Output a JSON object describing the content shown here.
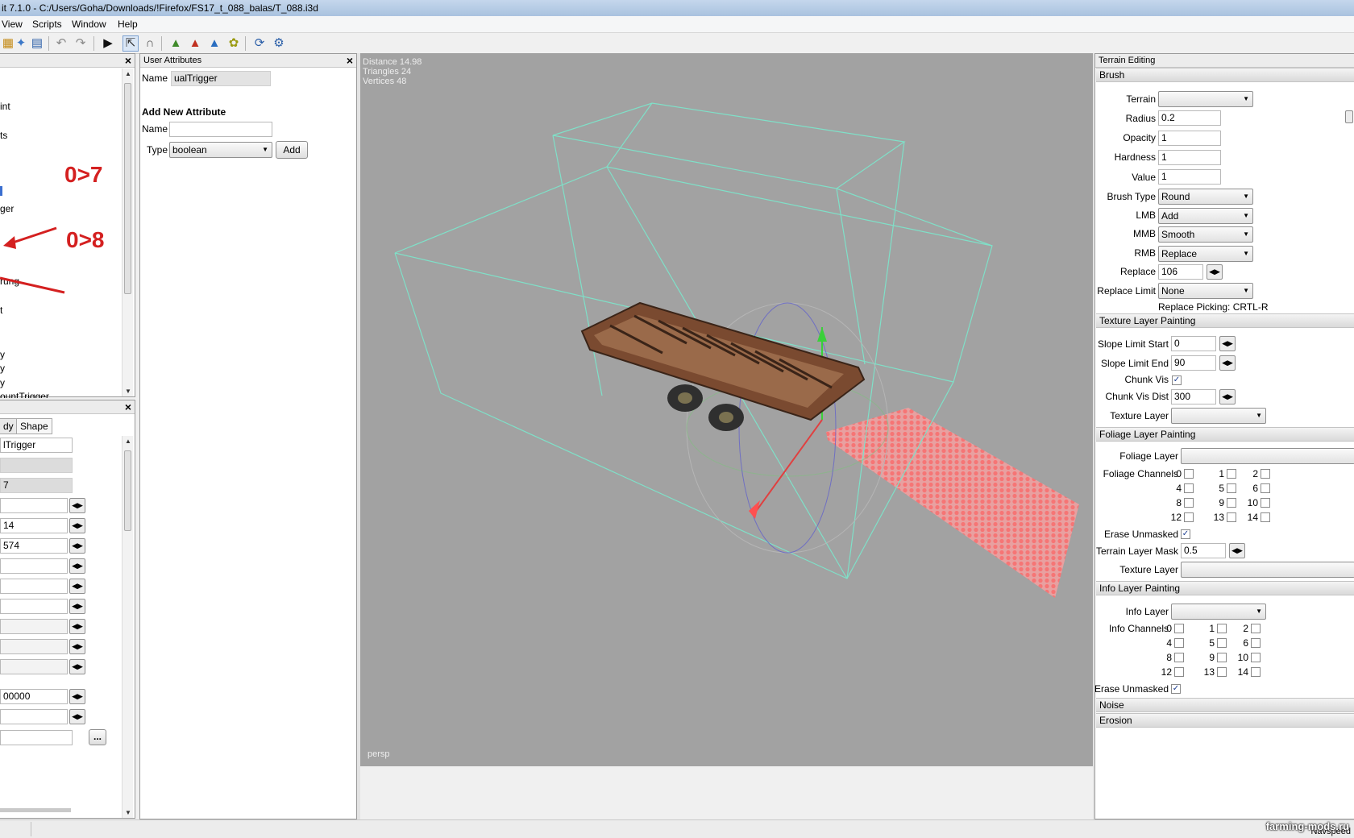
{
  "window": {
    "title": "it 7.1.0 - C:/Users/Goha/Downloads/!Firefox/FS17_t_088_balas/T_088.i3d"
  },
  "menu": {
    "view": "View",
    "scripts": "Scripts",
    "window": "Window",
    "help": "Help"
  },
  "toolbar": {
    "icons": [
      "open-icon",
      "save-icon",
      "import-icon",
      "undo-icon",
      "redo-icon",
      "play-icon",
      "select-icon",
      "magnet-icon",
      "terrain-icon",
      "paint-icon",
      "foliage-icon",
      "info-icon",
      "refresh-icon",
      "settings-icon"
    ]
  },
  "scenegraph": {
    "items": [
      "int",
      "ts",
      "ger",
      "rung",
      "t",
      "y",
      "y",
      "y",
      "ountTrigger"
    ],
    "annotations": [
      "0>7",
      "0>8"
    ]
  },
  "attributes_panel": {
    "tabs": [
      "dy",
      "Shape"
    ],
    "name_value": "lTrigger",
    "id_value": "7",
    "values": [
      "",
      "14",
      "574",
      "",
      "",
      "",
      "",
      "",
      "",
      "00000",
      "",
      ""
    ],
    "more_button": "..."
  },
  "user_attributes": {
    "title": "User Attributes",
    "name_label": "Name",
    "name_value": "ualTrigger",
    "add_heading": "Add New Attribute",
    "new_name_label": "Name",
    "new_name_value": "",
    "type_label": "Type",
    "type_value": "boolean",
    "add_button": "Add"
  },
  "viewport": {
    "distance": "Distance 14.98",
    "triangles": "Triangles 24",
    "vertices": "Vertices 48",
    "camera": "persp"
  },
  "terrain_editing": {
    "title": "Terrain Editing",
    "brush": {
      "header": "Brush",
      "terrain_label": "Terrain",
      "terrain_value": "",
      "radius_label": "Radius",
      "radius_value": "0.2",
      "opacity_label": "Opacity",
      "opacity_value": "1",
      "hardness_label": "Hardness",
      "hardness_value": "1",
      "value_label": "Value",
      "value_value": "1",
      "brush_type_label": "Brush Type",
      "brush_type_value": "Round",
      "lmb_label": "LMB",
      "lmb_value": "Add",
      "mmb_label": "MMB",
      "mmb_value": "Smooth",
      "rmb_label": "RMB",
      "rmb_value": "Replace",
      "replace_label": "Replace",
      "replace_value": "106",
      "replace_limit_label": "Replace Limit",
      "replace_limit_value": "None",
      "replace_picking": "Replace Picking: CRTL-R"
    },
    "texture": {
      "header": "Texture Layer Painting",
      "slope_start_label": "Slope Limit Start",
      "slope_start_value": "0",
      "slope_end_label": "Slope Limit End",
      "slope_end_value": "90",
      "chunk_vis_label": "Chunk Vis",
      "chunk_vis_checked": true,
      "chunk_vis_dist_label": "Chunk Vis Dist",
      "chunk_vis_dist_value": "300",
      "texture_layer_label": "Texture Layer",
      "texture_layer_value": ""
    },
    "foliage": {
      "header": "Foliage Layer Painting",
      "foliage_layer_label": "Foliage Layer",
      "foliage_layer_value": "",
      "channels_label": "Foliage Channels",
      "channels": [
        "0",
        "1",
        "2",
        "4",
        "5",
        "6",
        "8",
        "9",
        "10",
        "12",
        "13",
        "14"
      ],
      "erase_label": "Erase Unmasked",
      "erase_checked": true,
      "mask_label": "Terrain Layer Mask",
      "mask_value": "0.5",
      "texture_layer_label": "Texture Layer",
      "texture_layer_value": ""
    },
    "info": {
      "header": "Info Layer Painting",
      "info_layer_label": "Info Layer",
      "info_layer_value": "",
      "channels_label": "Info Channels",
      "channels": [
        "0",
        "1",
        "2",
        "4",
        "5",
        "6",
        "8",
        "9",
        "10",
        "12",
        "13",
        "14"
      ],
      "erase_label": "Erase Unmasked",
      "erase_checked": true
    },
    "noise": {
      "header": "Noise"
    },
    "erosion": {
      "header": "Erosion"
    }
  },
  "statusbar": {
    "navspeed": "Navspeed"
  },
  "watermark": "farming-mods.ru",
  "colors": {
    "wireframe": "#7fe0c8",
    "annotation": "#d42020",
    "viewport_bg": "#a2a2a2"
  }
}
